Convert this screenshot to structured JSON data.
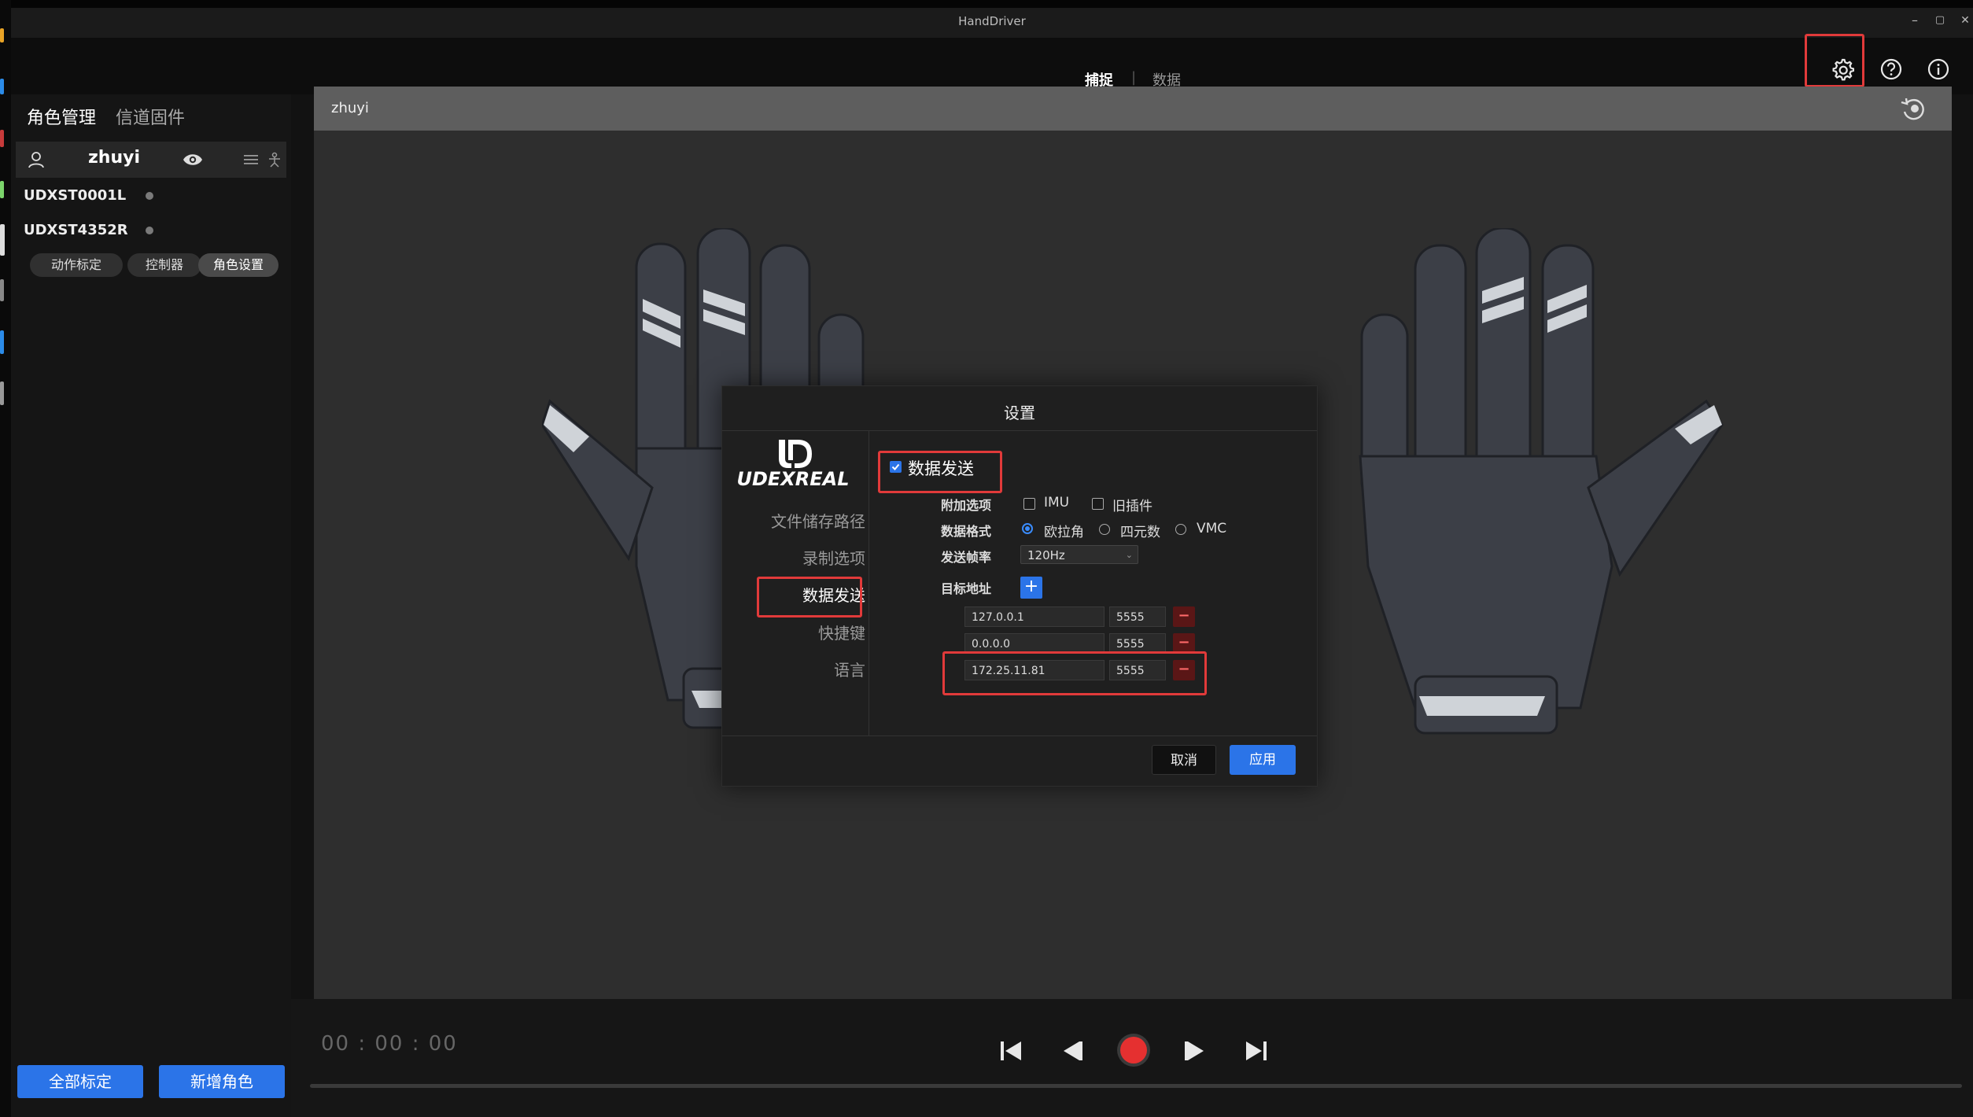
{
  "app": {
    "title": "HandDriver"
  },
  "window_controls": {
    "minimize": "–",
    "maximize": "▢",
    "close": "✕"
  },
  "top_tabs": {
    "capture": "捕捉",
    "separator": "|",
    "data": "数据"
  },
  "toolbar_icons": [
    "gear-icon",
    "help-icon",
    "info-icon"
  ],
  "left_panel": {
    "tabs": [
      "角色管理",
      "信道固件"
    ],
    "character": {
      "name": "zhuyi"
    },
    "devices": [
      "UDXST0001L",
      "UDXST4352R"
    ],
    "actions": [
      "动作标定",
      "控制器",
      "角色设置"
    ],
    "active_action": "角色设置",
    "bottom_buttons": {
      "calibrate_all": "全部标定",
      "add_character": "新增角色"
    }
  },
  "viewport": {
    "character_name": "zhuyi"
  },
  "playback": {
    "timecode": "00 : 00 : 00"
  },
  "dialog": {
    "title": "设置",
    "logo_text": "UDEXREAL",
    "nav": [
      "文件储存路径",
      "录制选项",
      "数据发送",
      "快捷键",
      "语言"
    ],
    "active_nav": "数据发送",
    "data_send": {
      "enable_label": "数据发送",
      "enabled": true,
      "extra_options_label": "附加选项",
      "extra_options": [
        {
          "label": "IMU",
          "checked": false
        },
        {
          "label": "旧插件",
          "checked": false
        }
      ],
      "format_label": "数据格式",
      "formats": [
        {
          "label": "欧拉角",
          "checked": true
        },
        {
          "label": "四元数",
          "checked": false
        },
        {
          "label": "VMC",
          "checked": false
        }
      ],
      "rate_label": "发送帧率",
      "rate_value": "120Hz",
      "target_label": "目标地址",
      "add_symbol": "+",
      "remove_symbol": "−",
      "targets": [
        {
          "address": "127.0.0.1",
          "port": "5555"
        },
        {
          "address": "0.0.0.0",
          "port": "5555"
        },
        {
          "address": "172.25.11.81",
          "port": "5555"
        }
      ]
    },
    "buttons": {
      "cancel": "取消",
      "apply": "应用"
    }
  },
  "colors": {
    "accent": "#2b74e8",
    "highlight_box": "#e13a3a",
    "record": "#e53030"
  }
}
